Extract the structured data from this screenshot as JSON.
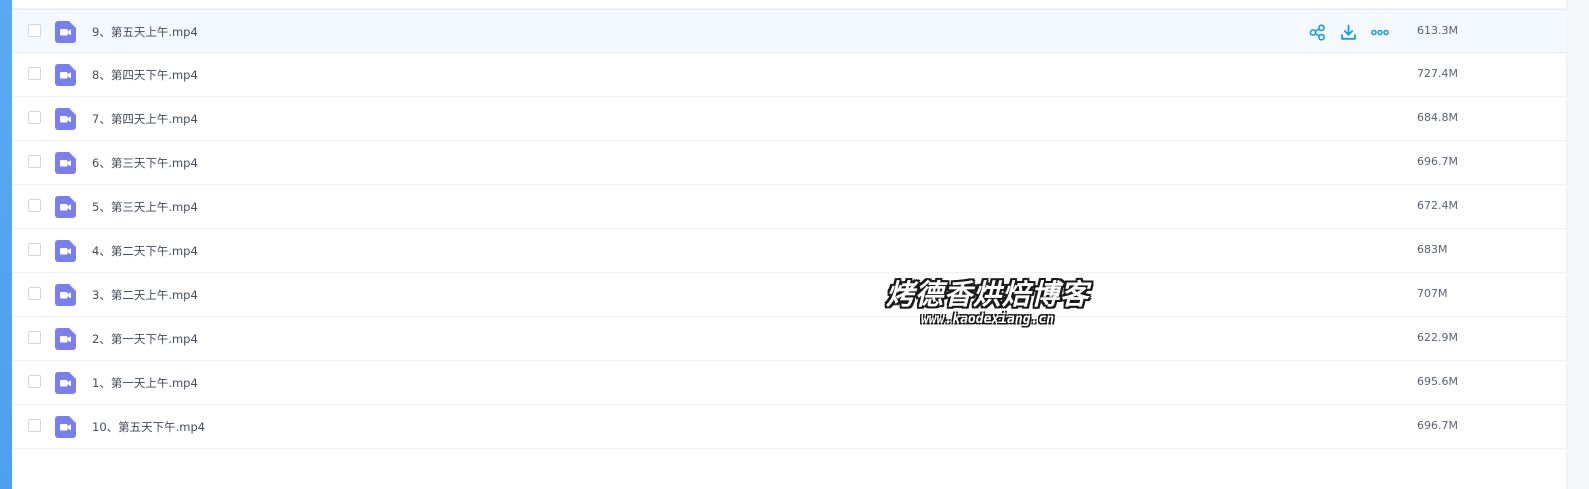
{
  "colors": {
    "accent": "#1a9bdc",
    "video_icon": "#7a7ff0",
    "hover_row": "#f4f9ff"
  },
  "row_actions": {
    "share_icon": "share-icon",
    "download_icon": "download-icon",
    "more_icon": "more-icon"
  },
  "files": [
    {
      "name": "9、第五天上午.mp4",
      "size": "613.3M",
      "hovered": true
    },
    {
      "name": "8、第四天下午.mp4",
      "size": "727.4M",
      "hovered": false
    },
    {
      "name": "7、第四天上午.mp4",
      "size": "684.8M",
      "hovered": false
    },
    {
      "name": "6、第三天下午.mp4",
      "size": "696.7M",
      "hovered": false
    },
    {
      "name": "5、第三天上午.mp4",
      "size": "672.4M",
      "hovered": false
    },
    {
      "name": "4、第二天下午.mp4",
      "size": "683M",
      "hovered": false
    },
    {
      "name": "3、第二天上午.mp4",
      "size": "707M",
      "hovered": false
    },
    {
      "name": "2、第一天下午.mp4",
      "size": "622.9M",
      "hovered": false
    },
    {
      "name": "1、第一天上午.mp4",
      "size": "695.6M",
      "hovered": false
    },
    {
      "name": "10、第五天下午.mp4",
      "size": "696.7M",
      "hovered": false
    }
  ],
  "watermark": {
    "title": "烤德香烘焙博客",
    "url": "www.kaodexiang.cn"
  }
}
